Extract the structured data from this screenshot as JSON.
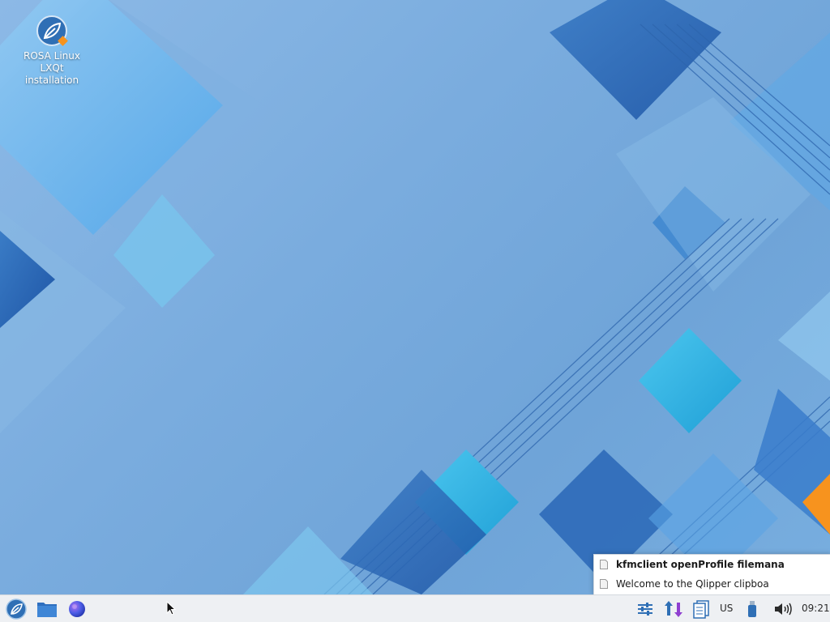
{
  "desktop": {
    "icons": [
      {
        "label": "ROSA Linux LXQt installation",
        "icon": "rosa-installer-icon"
      }
    ]
  },
  "qlipper": {
    "items": [
      {
        "text": "kfmclient openProfile filemana",
        "bold": true
      },
      {
        "text": "Welcome to the Qlipper clipboa",
        "bold": false
      }
    ]
  },
  "taskbar": {
    "launchers": [
      "main-menu-icon",
      "file-manager-icon",
      "web-browser-icon"
    ],
    "tray": {
      "keyboard_layout": "US",
      "clock": "09:21"
    }
  },
  "colors": {
    "accent": "#2f6fb5",
    "orange": "#f7931e",
    "taskbar_bg": "#eef0f3"
  }
}
